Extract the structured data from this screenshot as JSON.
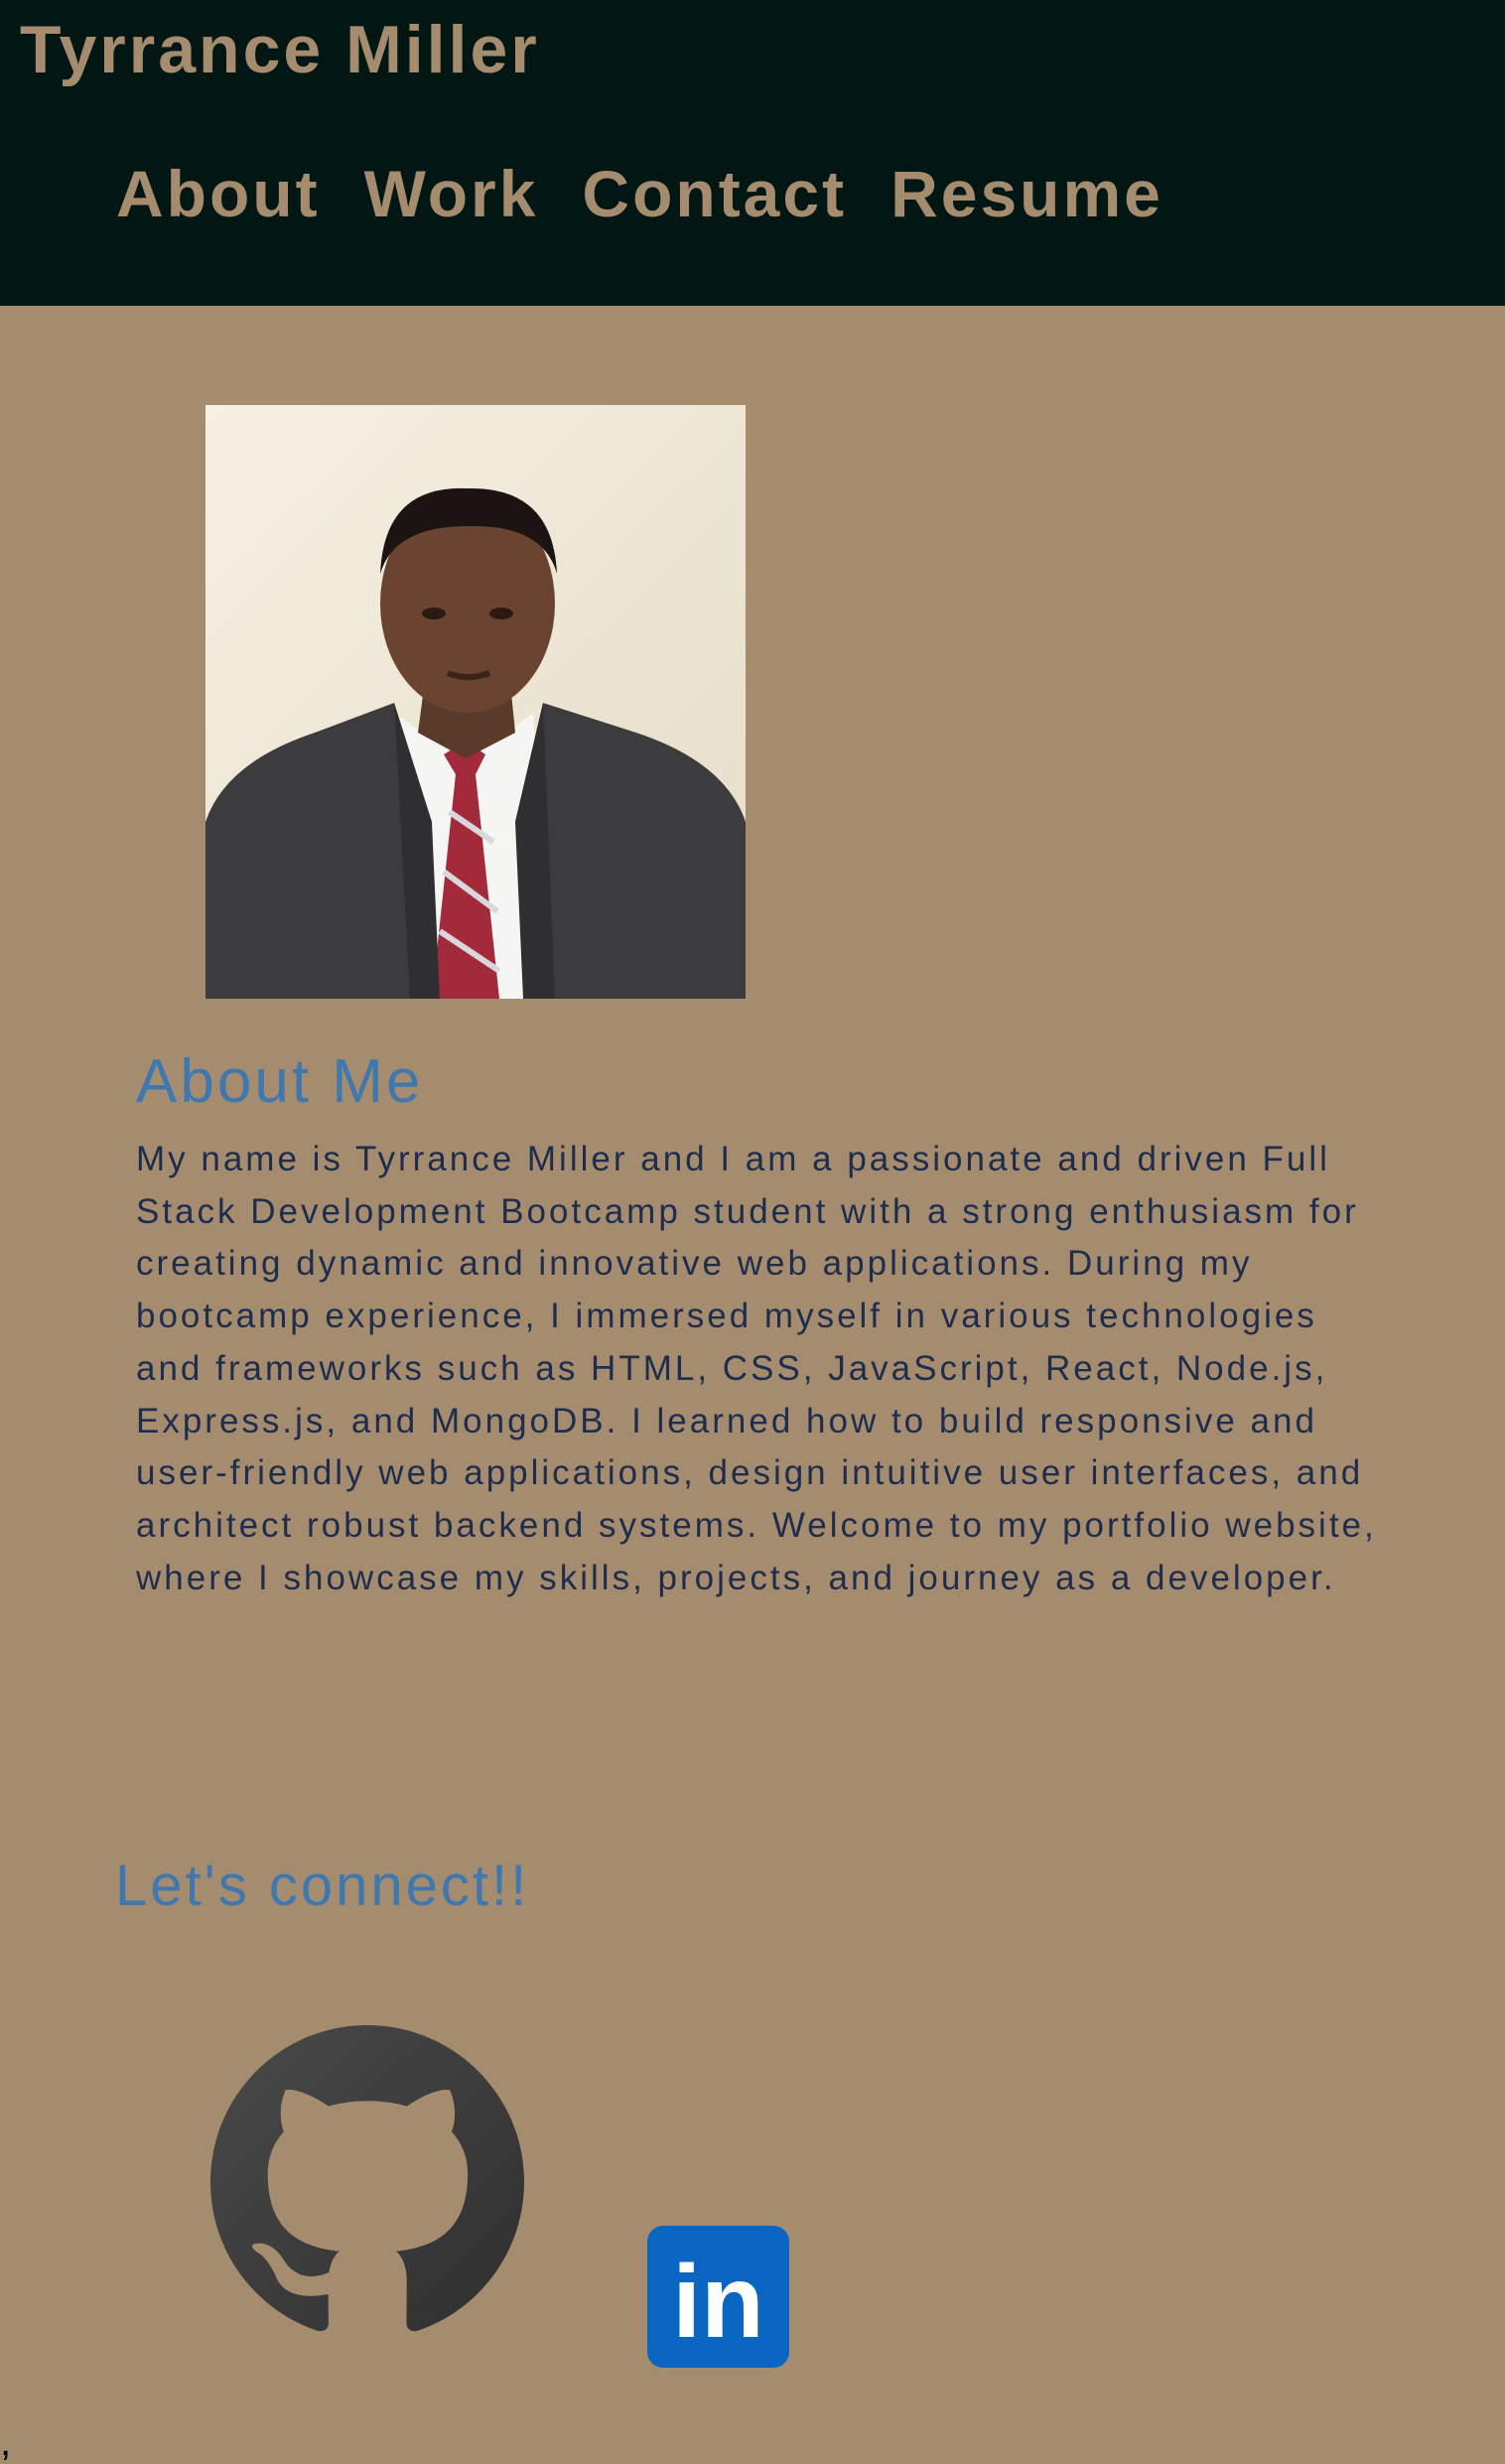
{
  "header": {
    "site_title": "Tyrrance Miller",
    "nav": [
      {
        "label": "About"
      },
      {
        "label": "Work"
      },
      {
        "label": "Contact"
      },
      {
        "label": "Resume"
      }
    ]
  },
  "about": {
    "heading": "About Me",
    "body": "My name is Tyrrance Miller and I am a passionate and driven Full Stack Development Bootcamp student with a strong enthusiasm for creating dynamic and innovative web applications. During my bootcamp experience, I immersed myself in various technologies and frameworks such as HTML, CSS, JavaScript, React, Node.js, Express.js, and MongoDB. I learned how to build responsive and user-friendly web applications, design intuitive user interfaces, and architect robust backend systems. Welcome to my portfolio website, where I showcase my skills, projects, and journey as a developer."
  },
  "connect": {
    "heading": "Let's connect!!",
    "links": [
      {
        "icon": "github-icon"
      },
      {
        "icon": "linkedin-icon",
        "text": "in"
      }
    ]
  },
  "footer": {
    "mark": ","
  },
  "colors": {
    "page_background": "#a68c6e",
    "header_background": "#021714",
    "accent_text": "#3f78ae",
    "body_text": "#1e2d4d",
    "linkedin_blue": "#0a66c2"
  }
}
